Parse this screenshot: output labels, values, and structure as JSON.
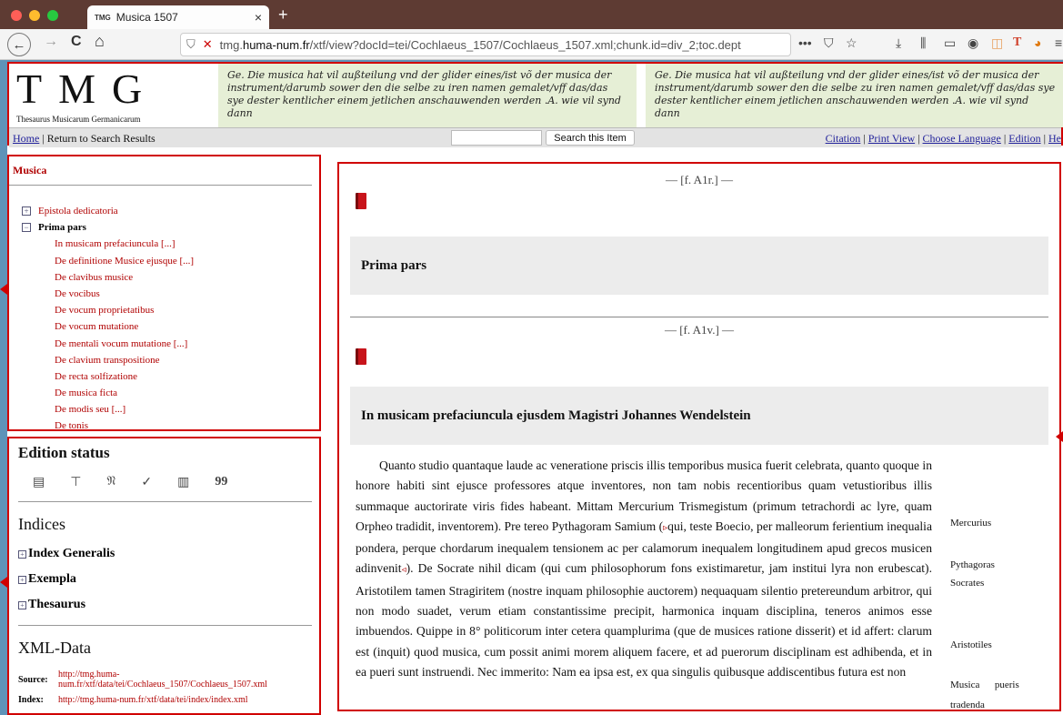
{
  "browser": {
    "tab_favicon": "TMG",
    "tab_title": "Musica 1507",
    "tab_close": "×",
    "new_tab": "+",
    "back": "←",
    "forward": "→",
    "reload": "C",
    "home": "⌂",
    "url_prefix": "tmg.",
    "url_domain": "huma-num.fr",
    "url_path": "/xtf/view?docId=tei/Cochlaeus_1507/Cochlaeus_1507.xml;chunk.id=div_2;toc.dept",
    "url_more": "•••"
  },
  "banner": {
    "logo_big": "TMG",
    "logo_small": "Thesaurus Musicarum Germanicarum",
    "fraktur_1": "Ge. Die musica hat vil außteilung vnd der glider eines/ist võ der musica der instrument/darumb sower den die selbe zu iren namen gemalet/vff das/das sye dester kentlicher einem jetlichen anschauwenden werden .A. wie vil synd dann",
    "fraktur_2": "Ge. Die musica hat vil außteilung vnd der glider eines/ist võ der musica der instrument/darumb sower den die selbe zu iren namen gemalet/vff das/das sye dester kentlicher einem jetlichen anschauwenden werden .A. wie vil synd dann"
  },
  "menubar": {
    "home": "Home",
    "sep1": " | ",
    "return": "Return to Search Results",
    "search_button": "Search this Item",
    "citation": "Citation",
    "print": "Print View",
    "language": "Choose Language",
    "edition": "Edition",
    "help": "He",
    "bar": " | "
  },
  "toc": {
    "title": "Musica",
    "items": [
      {
        "label": "Epistola dedicatoria",
        "pm": "+"
      },
      {
        "label": "Prima pars",
        "pm": "−"
      },
      {
        "label": "In musicam prefaciuncula [...]"
      },
      {
        "label": "De definitione Musice ejusque [...]"
      },
      {
        "label": "De clavibus musice"
      },
      {
        "label": "De vocibus"
      },
      {
        "label": "De vocum proprietatibus"
      },
      {
        "label": "De vocum mutatione"
      },
      {
        "label": "De mentali vocum mutatione [...]"
      },
      {
        "label": "De clavium transpositione"
      },
      {
        "label": "De recta solfizatione"
      },
      {
        "label": "De musica ficta"
      },
      {
        "label": "De modis seu [...]"
      },
      {
        "label": "De tonis"
      }
    ]
  },
  "side": {
    "edition_status": "Edition status",
    "edition_icons": [
      "▤",
      "⊤",
      "𝔑",
      "✓",
      "▥",
      "99"
    ],
    "indices": "Indices",
    "index_generalis": "Index Generalis",
    "exempla": "Exempla",
    "thesaurus": "Thesaurus",
    "xml_data": "XML-Data",
    "source_label": "Source:",
    "source_value": "http://tmg.huma-num.fr/xtf/data/tei/Cochlaeus_1507/Cochlaeus_1507.xml",
    "index_label": "Index:",
    "index_value": "http://tmg.huma-num.fr/xtf/data/tei/index/index.xml",
    "pm": "+"
  },
  "main": {
    "folio1": "— [f. A1r.] —",
    "heading1": "Prima pars",
    "folio2": "— [f. A1v.] —",
    "heading2": "In musicam prefaciuncula ejusdem Magistri Johannes Wendelstein",
    "para_a": "Quanto studio quantaque laude ac veneratione priscis illis temporibus musica fuerit celebrata, quanto quoque in honore habiti sint ejusce professores atque inventores, non tam nobis recentioribus quam vetustioribus illis summaque auctorirate viris fides habeant. Mittam Mercurium Trismegistum (primum tetrachordi ac lyre, quam Orpheo tradidit, inventorem). Pre tereo Pythagoram Samium (",
    "ptr_open": "▹",
    "para_b": "qui, teste Boecio, per malleorum ferientium inequalia pondera, perque chordarum inequalem tensionem ac per calamorum inequalem longitudinem apud grecos musicen adinvenit",
    "ptr_close": "◃",
    "para_c": "). De Socrate nihil dicam (qui cum philosophorum fons existimaretur, jam institui lyra non erubescat). Aristotilem tamen Stragiritem (nostre inquam philosophie auctorem) nequaquam silentio pretereundum arbitror, qui non modo suadet, verum etiam constantissime precipit, harmonica inquam disciplina, teneros animos esse imbuendos. Quippe in 8° politicorum inter cetera quamplurima (que de musices ratione disserit) et id affert: clarum est (inquit) quod musica, cum possit animi morem aliquem facere, et ad puerorum disciplinam est adhibenda, et in ea pueri sunt instruendi. Nec immerito: Nam ea ipsa est, ex qua singulis quibusque addiscentibus futura est non",
    "notes": [
      "Mercurius",
      "Pythagoras",
      "Socrates",
      "Aristotiles",
      "Musica      pueris",
      "tradenda"
    ]
  }
}
